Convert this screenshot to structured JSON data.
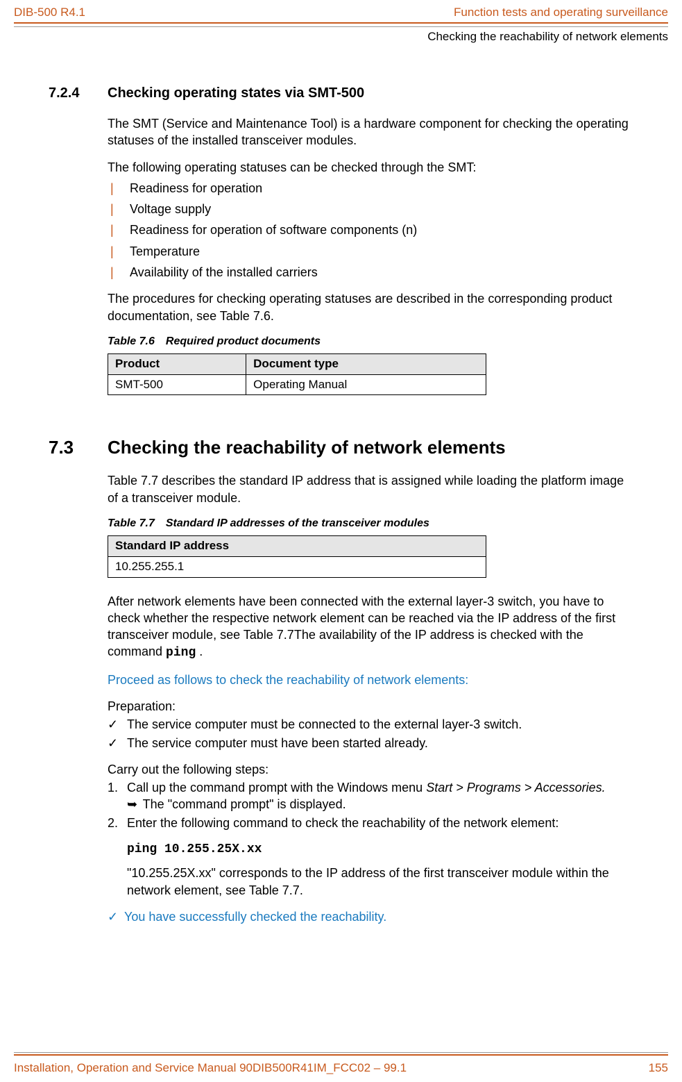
{
  "header": {
    "left": "DIB-500 R4.1",
    "right": "Function tests and operating surveillance",
    "sub": "Checking the reachability of network elements"
  },
  "sec724": {
    "num": "7.2.4",
    "title": "Checking operating states via SMT-500",
    "p1": "The SMT (Service and Maintenance Tool) is a hardware component for checking the operating statuses of the installed transceiver modules.",
    "p2": "The following operating statuses can be checked through the SMT:",
    "items": {
      "i0": "Readiness for operation",
      "i1": "Voltage supply",
      "i2": "Readiness for operation of software components (n)",
      "i3": "Temperature",
      "i4": "Availability of the installed carriers"
    },
    "p3": "The procedures for checking operating statuses are described in the corresponding product documentation, see Table 7.6.",
    "table_caption": "Table 7.6 Required product documents",
    "th1": "Product",
    "th2": "Document type",
    "td1": "SMT-500",
    "td2": "Operating Manual"
  },
  "sec73": {
    "num": "7.3",
    "title": "Checking the reachability of network elements",
    "p1": "Table 7.7 describes the standard IP address that is assigned while loading the platform image of a transceiver module.",
    "table_caption": "Table 7.7 Standard IP addresses of the transceiver modules",
    "th1": "Standard IP address",
    "td1": "10.255.255.1",
    "p2a": "After network elements have been connected with the external layer-3 switch, you have to check whether the respective network element can be reached via the IP address of the first transceiver module, see Table 7.7The availability of the IP address is checked with the command ",
    "p2cmd": "ping",
    "p2b": " .",
    "proc_head": "Proceed as follows to check the reachability of network elements:",
    "prep_label": "Preparation:",
    "prep": {
      "c0": "The service computer must be connected to the external layer-3 switch.",
      "c1": "The service computer must have been started already."
    },
    "steps_label": "Carry out the following steps:",
    "step1_num": "1.",
    "step1a": "Call up the command prompt with the Windows menu ",
    "step1b": "Start > Programs > Accessories.",
    "step1_arrow": "➥",
    "step1_res": " The \"command prompt\" is displayed.",
    "step2_num": "2.",
    "step2": "Enter the following command to check the reachability of the network element:",
    "cmd": "ping 10.255.25X.xx",
    "step2_note": "\"10.255.25X.xx\" corresponds to the IP address of the first transceiver module within the network element, see Table 7.7.",
    "success_tick": "✓",
    "success": "You have successfully checked the reachability."
  },
  "footer": {
    "left": "Installation, Operation and Service Manual 90DIB500R41IM_FCC02  –  99.1",
    "right": "155"
  }
}
